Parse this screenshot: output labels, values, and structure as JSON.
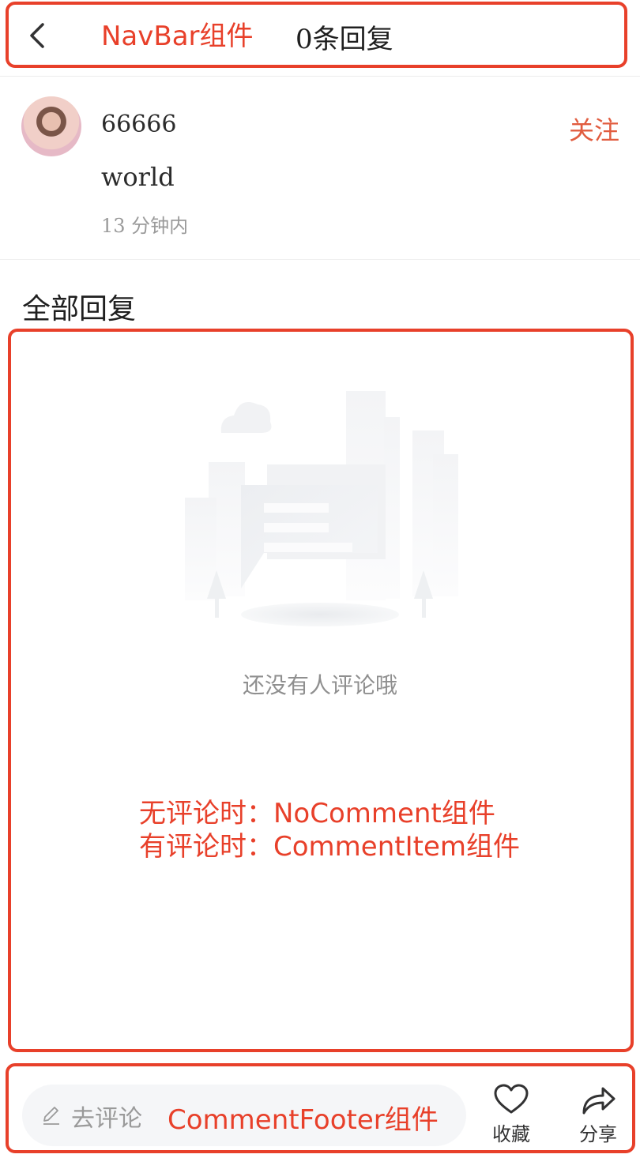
{
  "nav": {
    "title": "0条回复"
  },
  "reply": {
    "username": "66666",
    "follow_label": "关注",
    "content": "world",
    "time": "13 分钟内"
  },
  "section_title": "全部回复",
  "empty_state": {
    "text": "还没有人评论哦"
  },
  "footer": {
    "input_placeholder": "去评论",
    "collect_label": "收藏",
    "share_label": "分享"
  },
  "annotations": {
    "navbar": "NavBar组件",
    "no_comment": "无评论时：NoComment组件",
    "has_comment": "有评论时：CommentItem组件",
    "footer": "CommentFooter组件"
  },
  "icons": {
    "back": "chevron-left-icon",
    "pencil": "pencil-icon",
    "collect": "heart-icon",
    "share": "share-icon"
  },
  "colors": {
    "annotation_red": "#e8402a",
    "follow_red": "#e15c3f",
    "muted_text": "#9a9a9a"
  }
}
